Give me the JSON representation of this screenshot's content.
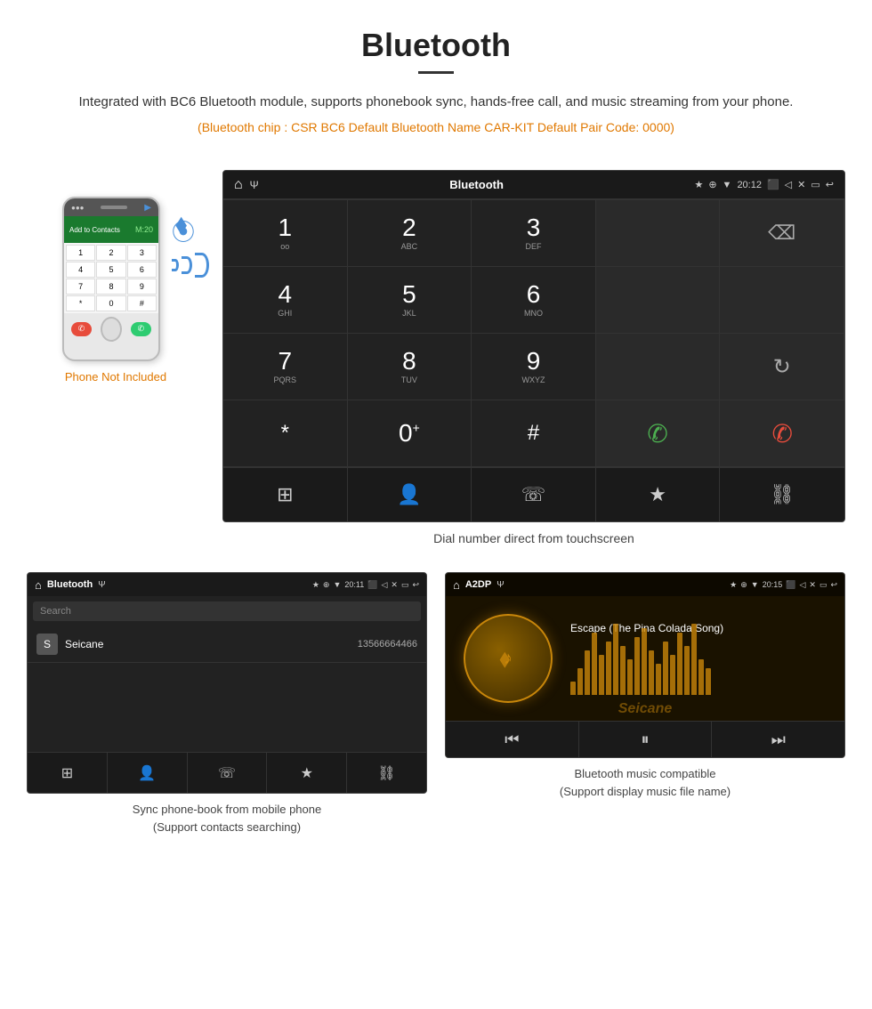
{
  "header": {
    "title": "Bluetooth",
    "description": "Integrated with BC6 Bluetooth module, supports phonebook sync, hands-free call, and music streaming from your phone.",
    "bluetooth_info": "(Bluetooth chip : CSR BC6   Default Bluetooth Name CAR-KIT    Default Pair Code: 0000)"
  },
  "phone_section": {
    "not_included_label": "Phone Not Included"
  },
  "dial_screen": {
    "title": "Bluetooth",
    "time": "20:12",
    "caption": "Dial number direct from touchscreen",
    "keys": [
      {
        "number": "1",
        "letters": "oo"
      },
      {
        "number": "2",
        "letters": "ABC"
      },
      {
        "number": "3",
        "letters": "DEF"
      },
      {
        "number": "4",
        "letters": "GHI"
      },
      {
        "number": "5",
        "letters": "JKL"
      },
      {
        "number": "6",
        "letters": "MNO"
      },
      {
        "number": "7",
        "letters": "PQRS"
      },
      {
        "number": "8",
        "letters": "TUV"
      },
      {
        "number": "9",
        "letters": "WXYZ"
      },
      {
        "number": "*",
        "letters": ""
      },
      {
        "number": "0",
        "letters": "+"
      },
      {
        "number": "#",
        "letters": ""
      }
    ]
  },
  "phonebook_screen": {
    "title": "Bluetooth",
    "time": "20:11",
    "search_placeholder": "Search",
    "contact": {
      "letter": "S",
      "name": "Seicane",
      "number": "13566664466"
    },
    "caption_line1": "Sync phone-book from mobile phone",
    "caption_line2": "(Support contacts searching)"
  },
  "music_screen": {
    "title": "A2DP",
    "time": "20:15",
    "song_title": "Escape (The Pina Colada Song)",
    "caption_line1": "Bluetooth music compatible",
    "caption_line2": "(Support display music file name)"
  },
  "eq_bars": [
    15,
    30,
    50,
    70,
    45,
    60,
    80,
    55,
    40,
    65,
    75,
    50,
    35,
    60,
    45,
    70,
    55,
    80,
    40,
    30
  ],
  "watermark": "Seicane"
}
